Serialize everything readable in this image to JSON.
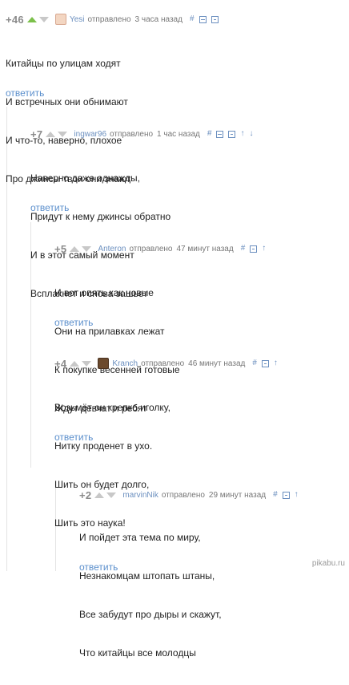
{
  "comments": [
    {
      "rating": "+46",
      "author": "Yesi",
      "sent": "отправлено",
      "time": "3 часа назад",
      "lines": [
        "Китайцы по улицам ходят",
        "И встречных они обнимают",
        "И что-то, наверно, плохое",
        "Про джинсы твои они знают"
      ],
      "reply": "ответить"
    },
    {
      "rating": "+7",
      "author": "ingwar96",
      "sent": "отправлено",
      "time": "1 час назад",
      "lines": [
        "Наверно даже однажды,",
        "Придут к нему джинсы обратно",
        "И в этот самый момент",
        "Всплакнет и снова зашьет"
      ],
      "reply": "ответить"
    },
    {
      "rating": "+5",
      "author": "Anteron",
      "sent": "отправлено",
      "time": "47 минут назад",
      "lines": [
        "И вот опять как новые",
        "Они на прилавках лежат",
        "К покупке весенней готовые",
        "Ждут девчат и ребят"
      ],
      "reply": "ответить"
    },
    {
      "rating": "+4",
      "author": "Kranch",
      "sent": "отправлено",
      "time": "46 минут назад",
      "lines": [
        "Возьмёт он крепко иголку,",
        "Нитку проденет в ухо.",
        "Шить он будет долго,",
        "Шить это наука!"
      ],
      "reply": "ответить"
    },
    {
      "rating": "+2",
      "author": "marvinNik",
      "sent": "отправлено",
      "time": "29 минут назад",
      "lines": [
        "И пойдет эта тема по миру,",
        "Незнакомцам штопать штаны,",
        "Все забудут про дыры и скажут,",
        "Что китайцы все молодцы"
      ],
      "reply": "ответить"
    }
  ],
  "tool_icons": {
    "hash": "#",
    "up": "↑",
    "down": "↓"
  },
  "watermark": "pikabu.ru",
  "colors": {
    "upvote_active": "#7bc04a",
    "link": "#5b8fcc",
    "author": "#6b8fbf"
  }
}
